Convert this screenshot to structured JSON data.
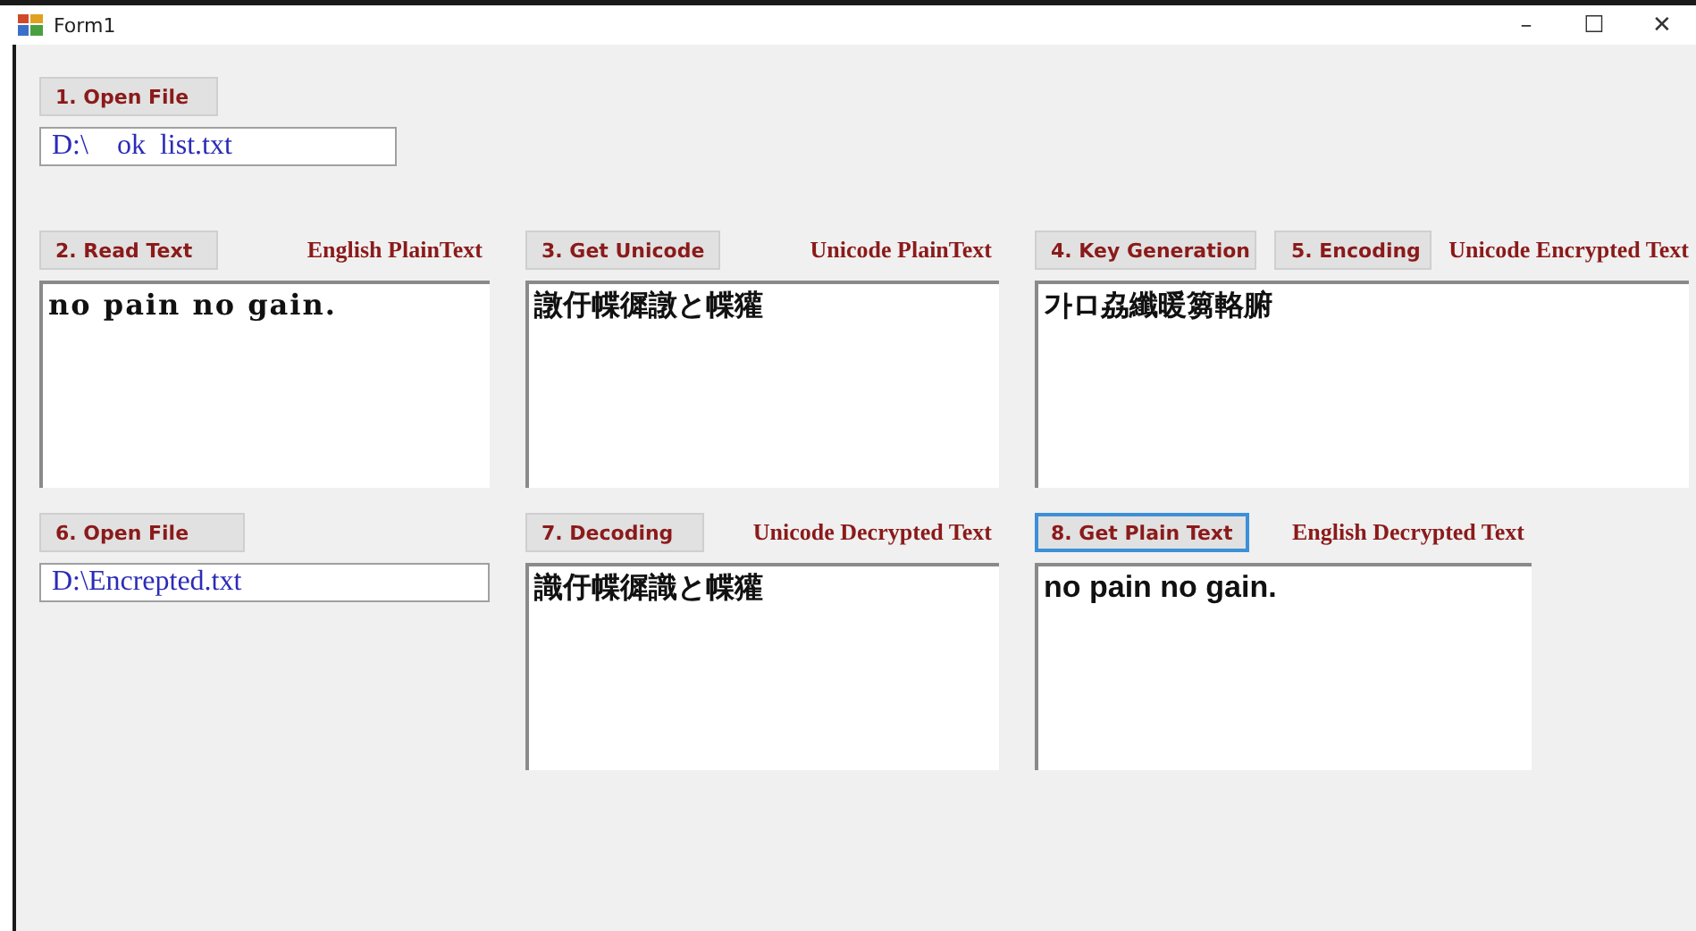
{
  "window": {
    "title": "Form1",
    "controls": [
      "–",
      "☐",
      "✕"
    ]
  },
  "open_file": {
    "button": {
      "label": "1. Open File",
      "focused": false
    },
    "path": "D:\\    ok  list.txt"
  },
  "row_1": [
    {
      "buttons": [
        {
          "label": "2. Read Text",
          "focused": false
        }
      ],
      "caption": "English PlainText",
      "text": "no pain no gain."
    },
    {
      "buttons": [
        {
          "label": "3. Get Unicode",
          "focused": false
        }
      ],
      "caption": "Unicode PlainText",
      "text": "譈㐵幉徲譈と幉獾"
    },
    {
      "buttons": [
        {
          "label": "4. Key Generation",
          "focused": false
        },
        {
          "label": "5. Encoding",
          "focused": false
        }
      ],
      "caption": "Unicode Encrypted Text",
      "text": "가ロ劦纖暖篘輅腑"
    }
  ],
  "row_2": {
    "open_file": {
      "button": {
        "label": "6. Open File",
        "focused": false
      },
      "path": "D:\\Encrepted.txt"
    },
    "panels": [
      {
        "buttons": [
          {
            "label": "7. Decoding",
            "focused": false
          }
        ],
        "caption": "Unicode Decrypted Text",
        "text": "識㐵幉徲識と幉獾"
      },
      {
        "buttons": [
          {
            "label": "8. Get Plain Text",
            "focused": true
          }
        ],
        "caption": "English Decrypted Text",
        "text": "no pain no gain."
      }
    ]
  }
}
